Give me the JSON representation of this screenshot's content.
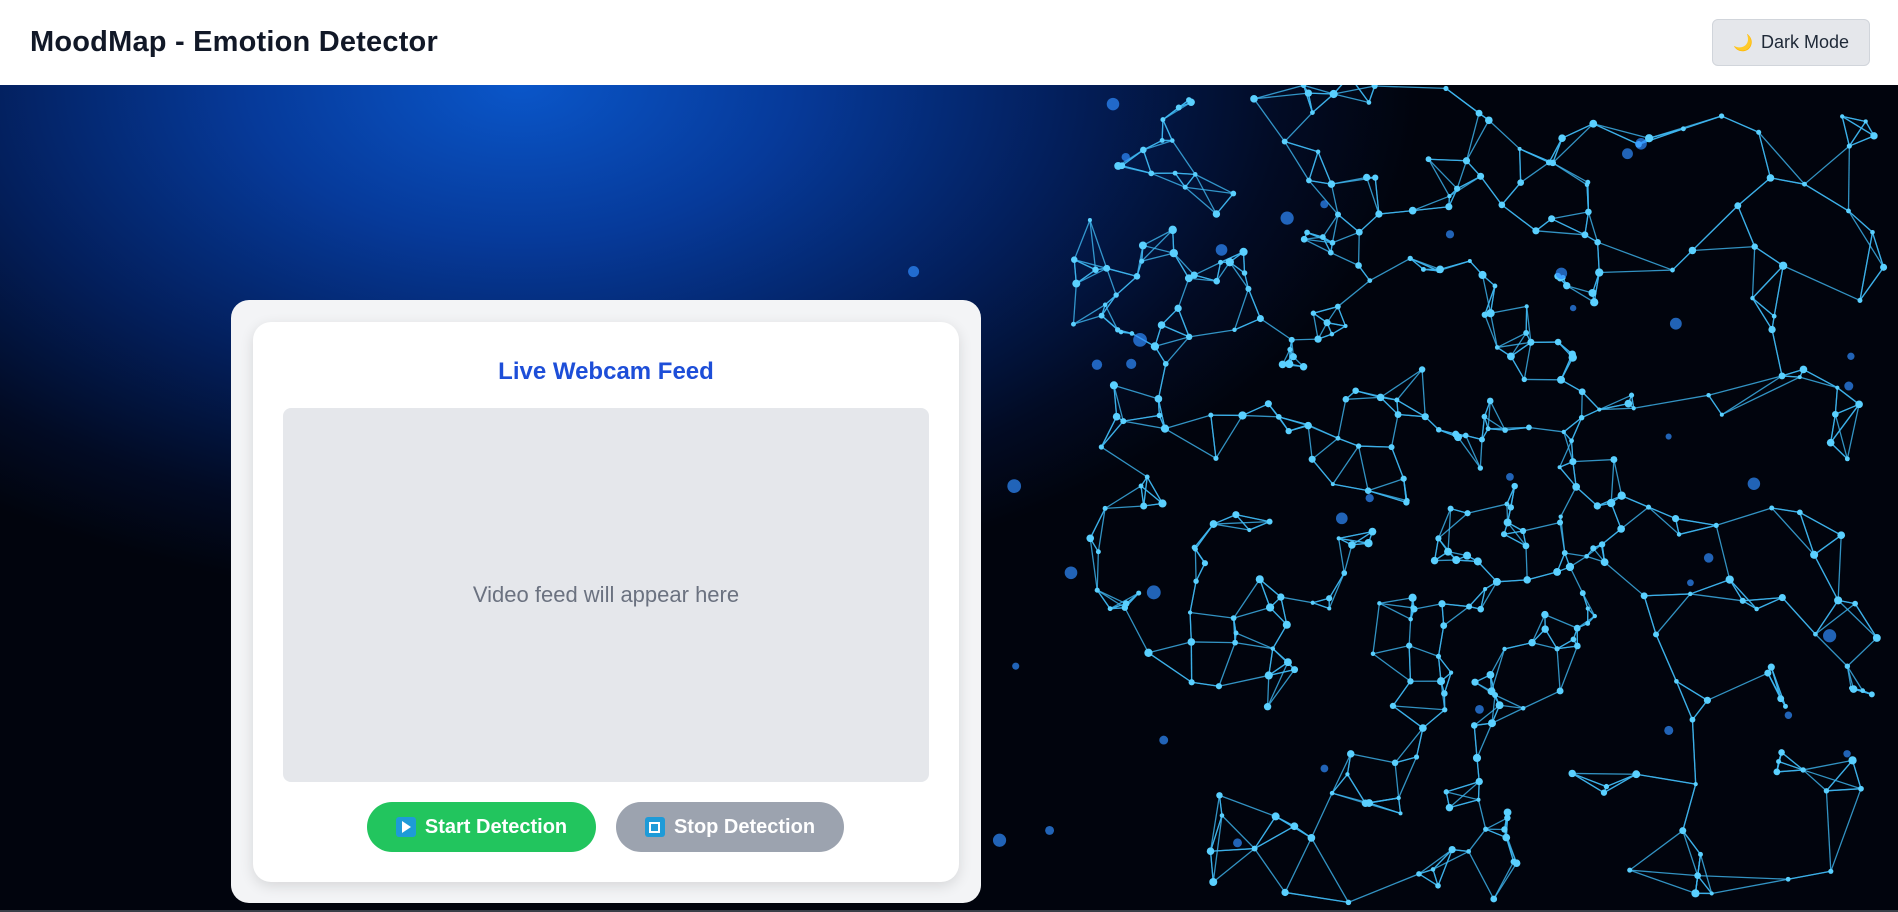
{
  "header": {
    "title": "MoodMap - Emotion Detector",
    "dark_mode_label": "Dark Mode",
    "dark_mode_icon": "moon-icon"
  },
  "card": {
    "title": "Live Webcam Feed",
    "video_placeholder": "Video feed will appear here",
    "start_label": "Start Detection",
    "start_icon": "play-icon",
    "stop_label": "Stop Detection",
    "stop_icon": "stop-icon"
  },
  "colors": {
    "accent_title": "#1d4ed8",
    "start_button": "#22c55e",
    "stop_button": "#9ca3af",
    "network_line": "#3fb7f0",
    "network_node": "#5ad0ff"
  }
}
